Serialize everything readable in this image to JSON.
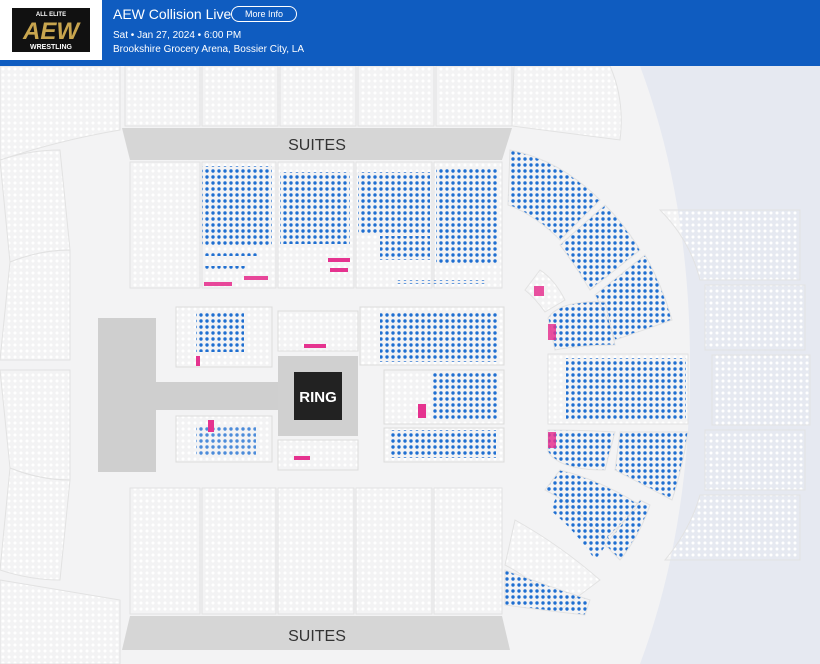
{
  "event": {
    "brand_line_1": "ALL ELITE",
    "brand_mark": "AEW",
    "brand_line_2": "WRESTLING",
    "title": "AEW Collision Live",
    "more_info_label": "More Info",
    "date_time": "Sat • Jan 27, 2024 • 6:00 PM",
    "venue": "Brookshire Grocery Arena, Bossier City, LA"
  },
  "map": {
    "suites_top_label": "SUITES",
    "suites_bottom_label": "SUITES",
    "ring_label": "RING"
  },
  "colors": {
    "header_blue": "#0f5cc0",
    "available_seat": "#1f6fd1",
    "highlight_seat": "#e5338f",
    "unavailable_seat": "#ffffff",
    "ring": "#222222"
  }
}
